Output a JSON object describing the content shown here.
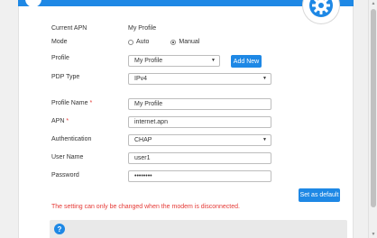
{
  "colors": {
    "accent": "#1e88e5",
    "error": "#e53935"
  },
  "current_apn": {
    "label": "Current APN",
    "value": "My Profile"
  },
  "mode": {
    "label": "Mode",
    "options": [
      {
        "label": "Auto",
        "checked": false
      },
      {
        "label": "Manual",
        "checked": true
      }
    ]
  },
  "profile": {
    "label": "Profile",
    "selected": "My Profile",
    "add_button": "Add New"
  },
  "pdp_type": {
    "label": "PDP Type",
    "selected": "IPv4"
  },
  "profile_name": {
    "label": "Profile Name",
    "required": "*",
    "value": "My Profile"
  },
  "apn": {
    "label": "APN",
    "required": "*",
    "value": "internet.apn"
  },
  "authentication": {
    "label": "Authentication",
    "selected": "CHAP"
  },
  "user_name": {
    "label": "User Name",
    "value": "user1"
  },
  "password": {
    "label": "Password",
    "value": "••••••••"
  },
  "set_default_button": "Set as default",
  "error_message": "The setting can only be changed when the modem is disconnected.",
  "help_icon_text": "?",
  "icons": {
    "settings": "gear-icon",
    "help": "help-icon",
    "caret": "caret-down-icon"
  }
}
